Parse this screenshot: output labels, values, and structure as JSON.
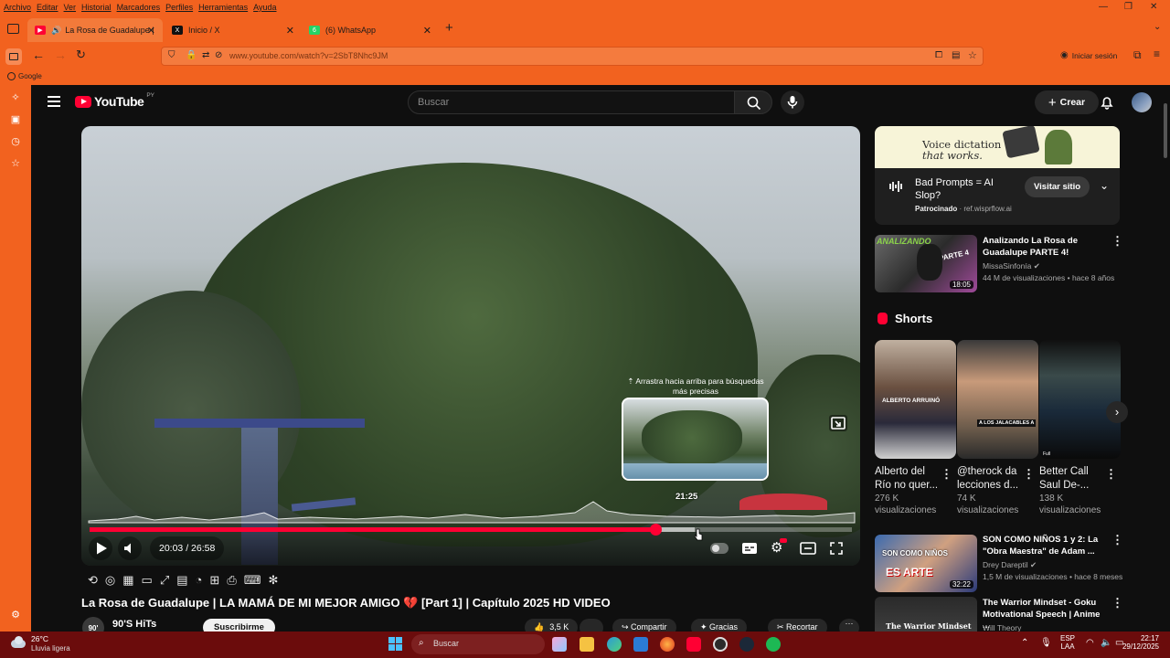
{
  "browser": {
    "menu": [
      "Archivo",
      "Editar",
      "Ver",
      "Historial",
      "Marcadores",
      "Perfiles",
      "Herramientas",
      "Ayuda"
    ],
    "tabs": [
      {
        "title": "La Rosa de Guadalupe | LA",
        "active": true
      },
      {
        "title": "Inicio / X",
        "active": false
      },
      {
        "title": "(6) WhatsApp",
        "active": false,
        "badge": "6"
      }
    ],
    "url": "www.youtube.com/watch?v=2SbT8Nhc9JM",
    "signin": "Iniciar sesión",
    "bookmark": "Google"
  },
  "youtube": {
    "logo": "YouTube",
    "region": "PY",
    "search_placeholder": "Buscar",
    "create": "Crear"
  },
  "player": {
    "time_current": "20:03",
    "time_total": "26:58",
    "time_display": "20:03 / 26:58",
    "preview_time": "21:25",
    "hint": "Arrastra hacia arriba para búsquedas más precisas",
    "progress": 0.7426,
    "hover_fraction": 0.7943
  },
  "video": {
    "title": "La Rosa de Guadalupe | LA MAMÁ DE MI MEJOR AMIGO 💔 [Part 1] | Capítulo 2025 HD VIDEO",
    "channel": "90'S HiTs",
    "channel_avatar": "90'",
    "subscribe": "Suscribirme",
    "likes": "3,5 K",
    "share": "Compartir",
    "thanks": "Gracias",
    "clip": "Recortar"
  },
  "ad": {
    "banner_line1": "Voice dictation",
    "banner_line2": "that works.",
    "title": "Bad Prompts = AI Slop?",
    "sponsored": "Patrocinado",
    "domain": "ref.wisprflow.ai",
    "cta": "Visitar sitio"
  },
  "recommendations": [
    {
      "title": "Analizando La Rosa de Guadalupe PARTE 4!",
      "channel": "MissaSinfonía",
      "meta": "44 M de visualizaciones • hace 8 años",
      "duration": "18:05",
      "thumb_text": "ANALIZANDO",
      "thumb_text2": "PARTE 4"
    },
    {
      "title": "SON COMO NIÑOS 1 y 2: La \"Obra Maestra\" de Adam ...",
      "channel": "Drey Dareptil",
      "meta": "1,5 M de visualizaciones • hace 8 meses",
      "duration": "32:22",
      "thumb_text": "SON COMO NIÑOS",
      "thumb_text2": "ES ARTE"
    },
    {
      "title": "The Warrior Mindset - Goku Motivational Speech | Anime ...",
      "channel": "Will Theory",
      "meta": "",
      "duration": "",
      "thumb_text": "The Warrior Mindset",
      "thumb_text2": ""
    }
  ],
  "shorts": {
    "heading": "Shorts",
    "items": [
      {
        "title": "Alberto del Río no quer...",
        "views": "276 K visualizaciones",
        "thumb_text": "ALBERTO ARRUINÓ"
      },
      {
        "title": "@therock da lecciones d...",
        "views": "74 K visualizaciones",
        "thumb_text": "A LOS JALACABLES A"
      },
      {
        "title": "Better Call Saul De-...",
        "views": "138 K visualizaciones",
        "thumb_text": "Full"
      }
    ]
  },
  "taskbar": {
    "weather_temp": "26°C",
    "weather_desc": "Lluvia ligera",
    "search": "Buscar",
    "lang": "ESP",
    "lang2": "LAA",
    "time": "22:17",
    "date": "29/12/2025"
  },
  "colors": {
    "accent": "#f2621f",
    "yt_red": "#ff0033",
    "taskbar": "#6b0c0c",
    "page_bg": "#0f0f0f"
  }
}
